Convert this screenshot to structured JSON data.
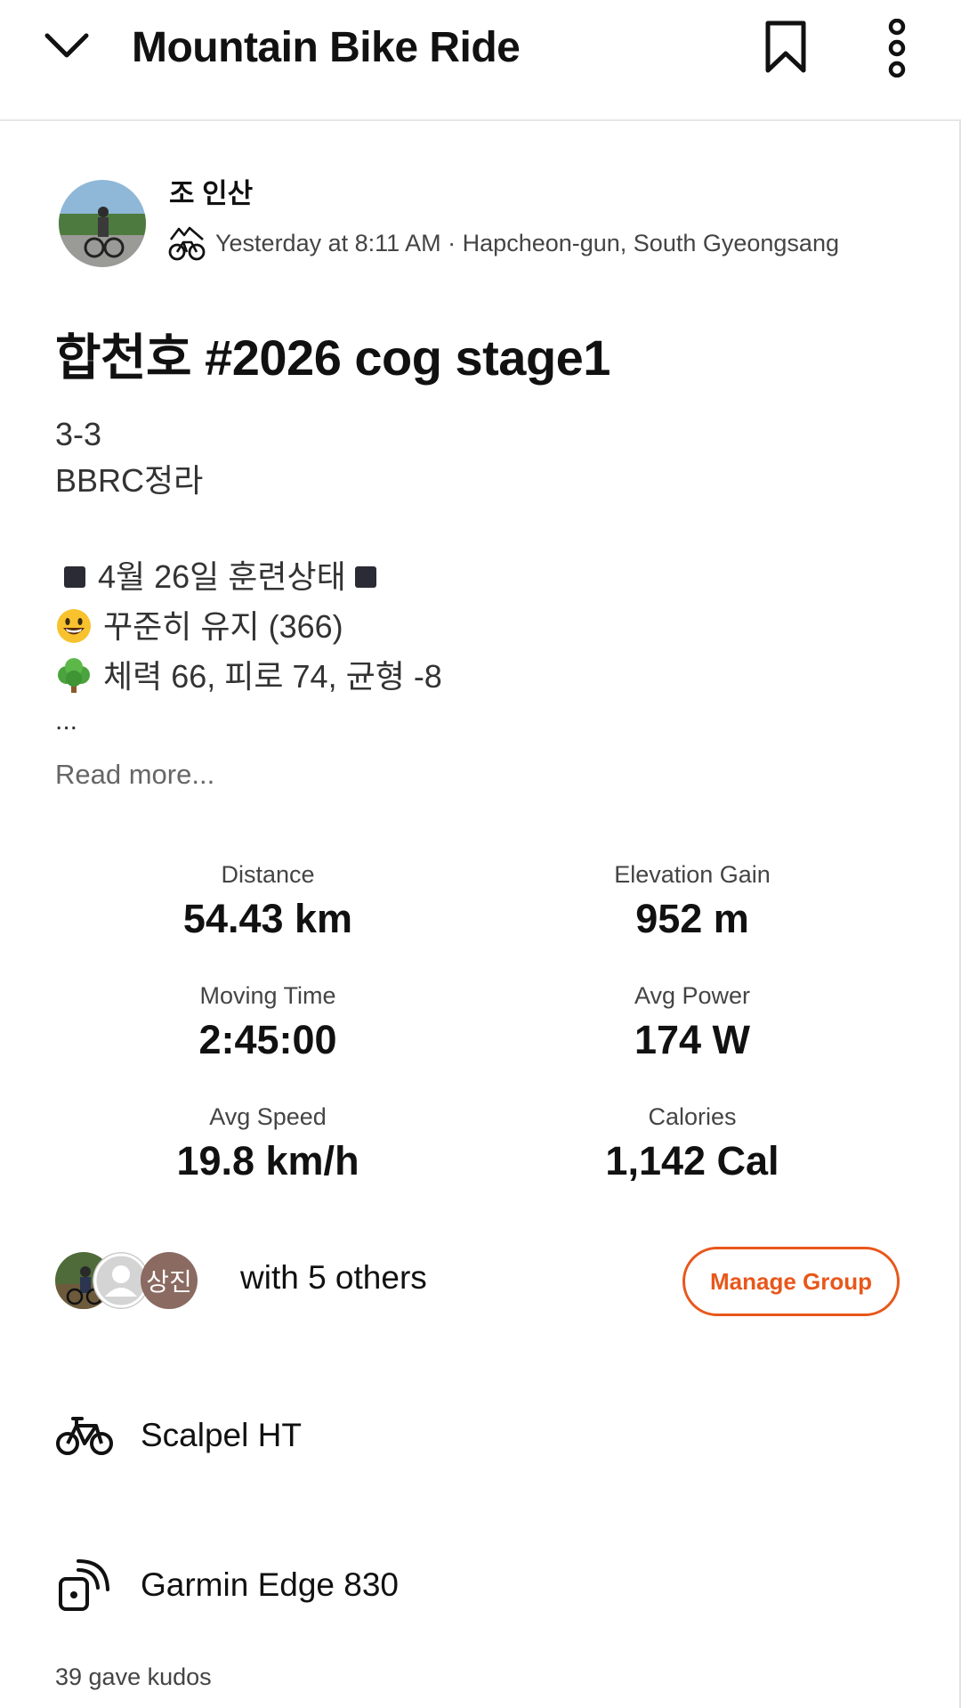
{
  "header": {
    "title": "Mountain Bike Ride"
  },
  "athlete": {
    "name": "조 인산",
    "meta": "Yesterday at 8:11 AM · Hapcheon-gun, South Gyeongsang"
  },
  "activity": {
    "title": "합천호 #2026 cog stage1",
    "description": {
      "line1": "3-3",
      "line2": "BBRC정라",
      "line3": "4월 26일 훈련상태",
      "line4": "꾸준히 유지 (366)",
      "line5": "체력 66, 피로 74, 균형 -8",
      "ellipsis": "..."
    },
    "read_more": "Read more..."
  },
  "stats": [
    {
      "label": "Distance",
      "value": "54.43 km"
    },
    {
      "label": "Elevation Gain",
      "value": "952 m"
    },
    {
      "label": "Moving Time",
      "value": "2:45:00"
    },
    {
      "label": "Avg Power",
      "value": "174 W"
    },
    {
      "label": "Avg Speed",
      "value": "19.8 km/h"
    },
    {
      "label": "Calories",
      "value": "1,142 Cal"
    }
  ],
  "group": {
    "avatar_initials": "상진",
    "with_others": "with 5 others",
    "manage_label": "Manage Group"
  },
  "gear": {
    "bike": "Scalpel HT",
    "device": "Garmin Edge 830"
  },
  "kudos": "39 gave kudos",
  "colors": {
    "accent": "#e8571b",
    "text": "#111111",
    "muted": "#444444"
  }
}
